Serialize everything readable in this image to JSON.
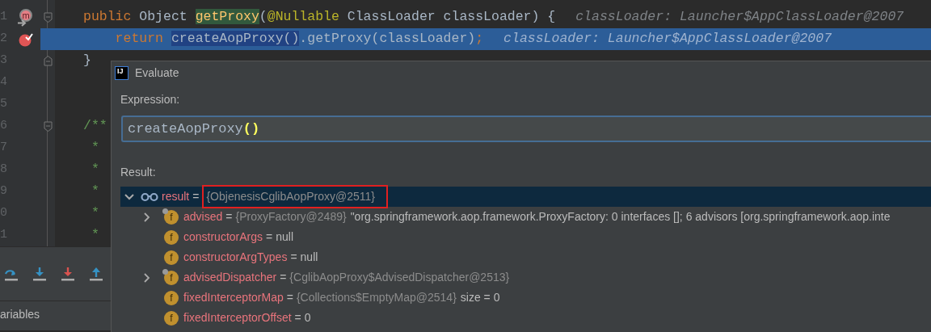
{
  "editor": {
    "lines": [
      {
        "number": "1",
        "fold": {
          "kind": "start"
        },
        "gutter_icon": {
          "kind": "override",
          "letter": "m"
        },
        "tokens": [
          {
            "text": "public ",
            "kind": "keyword"
          },
          {
            "text": "Object ",
            "kind": "plain"
          },
          {
            "text": "getProxy",
            "kind": "usage"
          },
          {
            "text": "(",
            "kind": "plain"
          },
          {
            "text": "@Nullable",
            "kind": "annotation"
          },
          {
            "text": " ClassLoader classLoader) {",
            "kind": "plain"
          }
        ],
        "hint": "classLoader: Launcher$AppClassLoader@2007",
        "current": false
      },
      {
        "number": "2",
        "gutter_icon": {
          "kind": "breakpoint"
        },
        "tokens": [
          {
            "text": "    return ",
            "kind": "keyword"
          },
          {
            "text": "createAopProxy()",
            "kind": "selection"
          },
          {
            "text": ".getProxy(classLoader)",
            "kind": "plain"
          },
          {
            "text": ";",
            "kind": "keyword"
          }
        ],
        "hint": "classLoader: Launcher$AppClassLoader@2007",
        "current": true
      },
      {
        "number": "3",
        "fold": {
          "kind": "end"
        },
        "tokens": [
          {
            "text": "}",
            "kind": "plain"
          }
        ],
        "current": false
      },
      {
        "number": "4",
        "current": false
      },
      {
        "number": "5",
        "current": false
      },
      {
        "number": "6",
        "fold": {
          "kind": "start"
        },
        "tokens": [
          {
            "text": "/**",
            "kind": "comment"
          }
        ],
        "current": false
      },
      {
        "number": "7",
        "tokens": [
          {
            "text": " *",
            "kind": "comment"
          }
        ],
        "current": false
      },
      {
        "number": "8",
        "tokens": [
          {
            "text": " *",
            "kind": "comment"
          }
        ],
        "current": false
      },
      {
        "number": "9",
        "tokens": [
          {
            "text": " *",
            "kind": "comment"
          }
        ],
        "current": false
      },
      {
        "number": "0",
        "tokens": [
          {
            "text": " *",
            "kind": "comment"
          }
        ],
        "current": false
      },
      {
        "number": "1",
        "tokens": [
          {
            "text": " *",
            "kind": "comment"
          }
        ],
        "current": false
      }
    ]
  },
  "debugger": {
    "toolbar": [
      {
        "kind": "step-over"
      },
      {
        "kind": "step-into"
      },
      {
        "kind": "force-step-into"
      },
      {
        "kind": "step-out"
      }
    ],
    "tab": "ariables"
  },
  "dialog": {
    "logo": "IJ",
    "title": "Evaluate",
    "expression_label": "Expression:",
    "expression": [
      {
        "text": "createAopProxy",
        "kind": "plain"
      },
      {
        "text": "()",
        "kind": "brace-match"
      }
    ],
    "result_label": "Result:",
    "result": {
      "name": "result",
      "operator": "=",
      "value": "{ObjenesisCglibAopProxy@2511}",
      "expanded": true,
      "selected": true,
      "highlighted": true,
      "children": [
        {
          "icon": "f",
          "name": "advised",
          "operator": "=",
          "value": "{ProxyFactory@2489}",
          "kind": "ref",
          "extra": "\"org.springframework.aop.framework.ProxyFactory: 0 interfaces []; 6 advisors [org.springframework.aop.inte",
          "expandable": true,
          "final": true
        },
        {
          "icon": "f",
          "name": "constructorArgs",
          "operator": "=",
          "value": "null",
          "kind": "literal",
          "expandable": false,
          "final": false
        },
        {
          "icon": "f",
          "name": "constructorArgTypes",
          "operator": "=",
          "value": "null",
          "kind": "literal",
          "expandable": false,
          "final": false
        },
        {
          "icon": "f",
          "name": "advisedDispatcher",
          "operator": "=",
          "value": "{CglibAopProxy$AdvisedDispatcher@2513}",
          "kind": "ref",
          "expandable": true,
          "final": true
        },
        {
          "icon": "f",
          "name": "fixedInterceptorMap",
          "operator": "=",
          "value": "{Collections$EmptyMap@2514}",
          "kind": "ref",
          "extra": "size = 0",
          "expandable": false,
          "final": false
        },
        {
          "icon": "f",
          "name": "fixedInterceptorOffset",
          "operator": "=",
          "value": "0",
          "kind": "literal",
          "expandable": false,
          "final": false
        }
      ]
    }
  }
}
